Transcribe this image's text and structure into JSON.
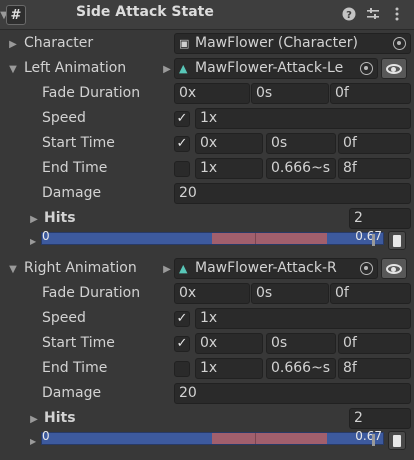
{
  "header": {
    "title": "Side Attack State",
    "script_glyph": "#"
  },
  "character": {
    "label": "Character",
    "value": "MawFlower (Character)"
  },
  "animations": [
    {
      "label": "Left Animation",
      "clip": "MawFlower-Attack-Le",
      "fade_duration": {
        "label": "Fade Duration",
        "v1": "0x",
        "v2": "0s",
        "v3": "0f"
      },
      "speed": {
        "label": "Speed",
        "checked": true,
        "value": "1x"
      },
      "start_time": {
        "label": "Start Time",
        "checked": true,
        "v1": "0x",
        "v2": "0s",
        "v3": "0f"
      },
      "end_time": {
        "label": "End Time",
        "checked": false,
        "v1": "1x",
        "v2": "0.666~s",
        "v3": "8f"
      },
      "damage": {
        "label": "Damage",
        "value": "20"
      },
      "hits": {
        "label": "Hits",
        "count": "2"
      },
      "timeline": {
        "start": "0",
        "end": "0.67"
      }
    },
    {
      "label": "Right Animation",
      "clip": "MawFlower-Attack-R",
      "fade_duration": {
        "label": "Fade Duration",
        "v1": "0x",
        "v2": "0s",
        "v3": "0f"
      },
      "speed": {
        "label": "Speed",
        "checked": true,
        "value": "1x"
      },
      "start_time": {
        "label": "Start Time",
        "checked": true,
        "v1": "0x",
        "v2": "0s",
        "v3": "0f"
      },
      "end_time": {
        "label": "End Time",
        "checked": false,
        "v1": "1x",
        "v2": "0.666~s",
        "v3": "8f"
      },
      "damage": {
        "label": "Damage",
        "value": "20"
      },
      "hits": {
        "label": "Hits",
        "count": "2"
      },
      "timeline": {
        "start": "0",
        "end": "0.67"
      }
    }
  ],
  "glyphs": {
    "check": "✓",
    "fold_open": "▼",
    "fold_closed": "▶"
  },
  "colors": {
    "timeline_bg": "#3d5a9e",
    "hit_range": "#a15f6d",
    "clip_icon": "#58c7b8"
  }
}
